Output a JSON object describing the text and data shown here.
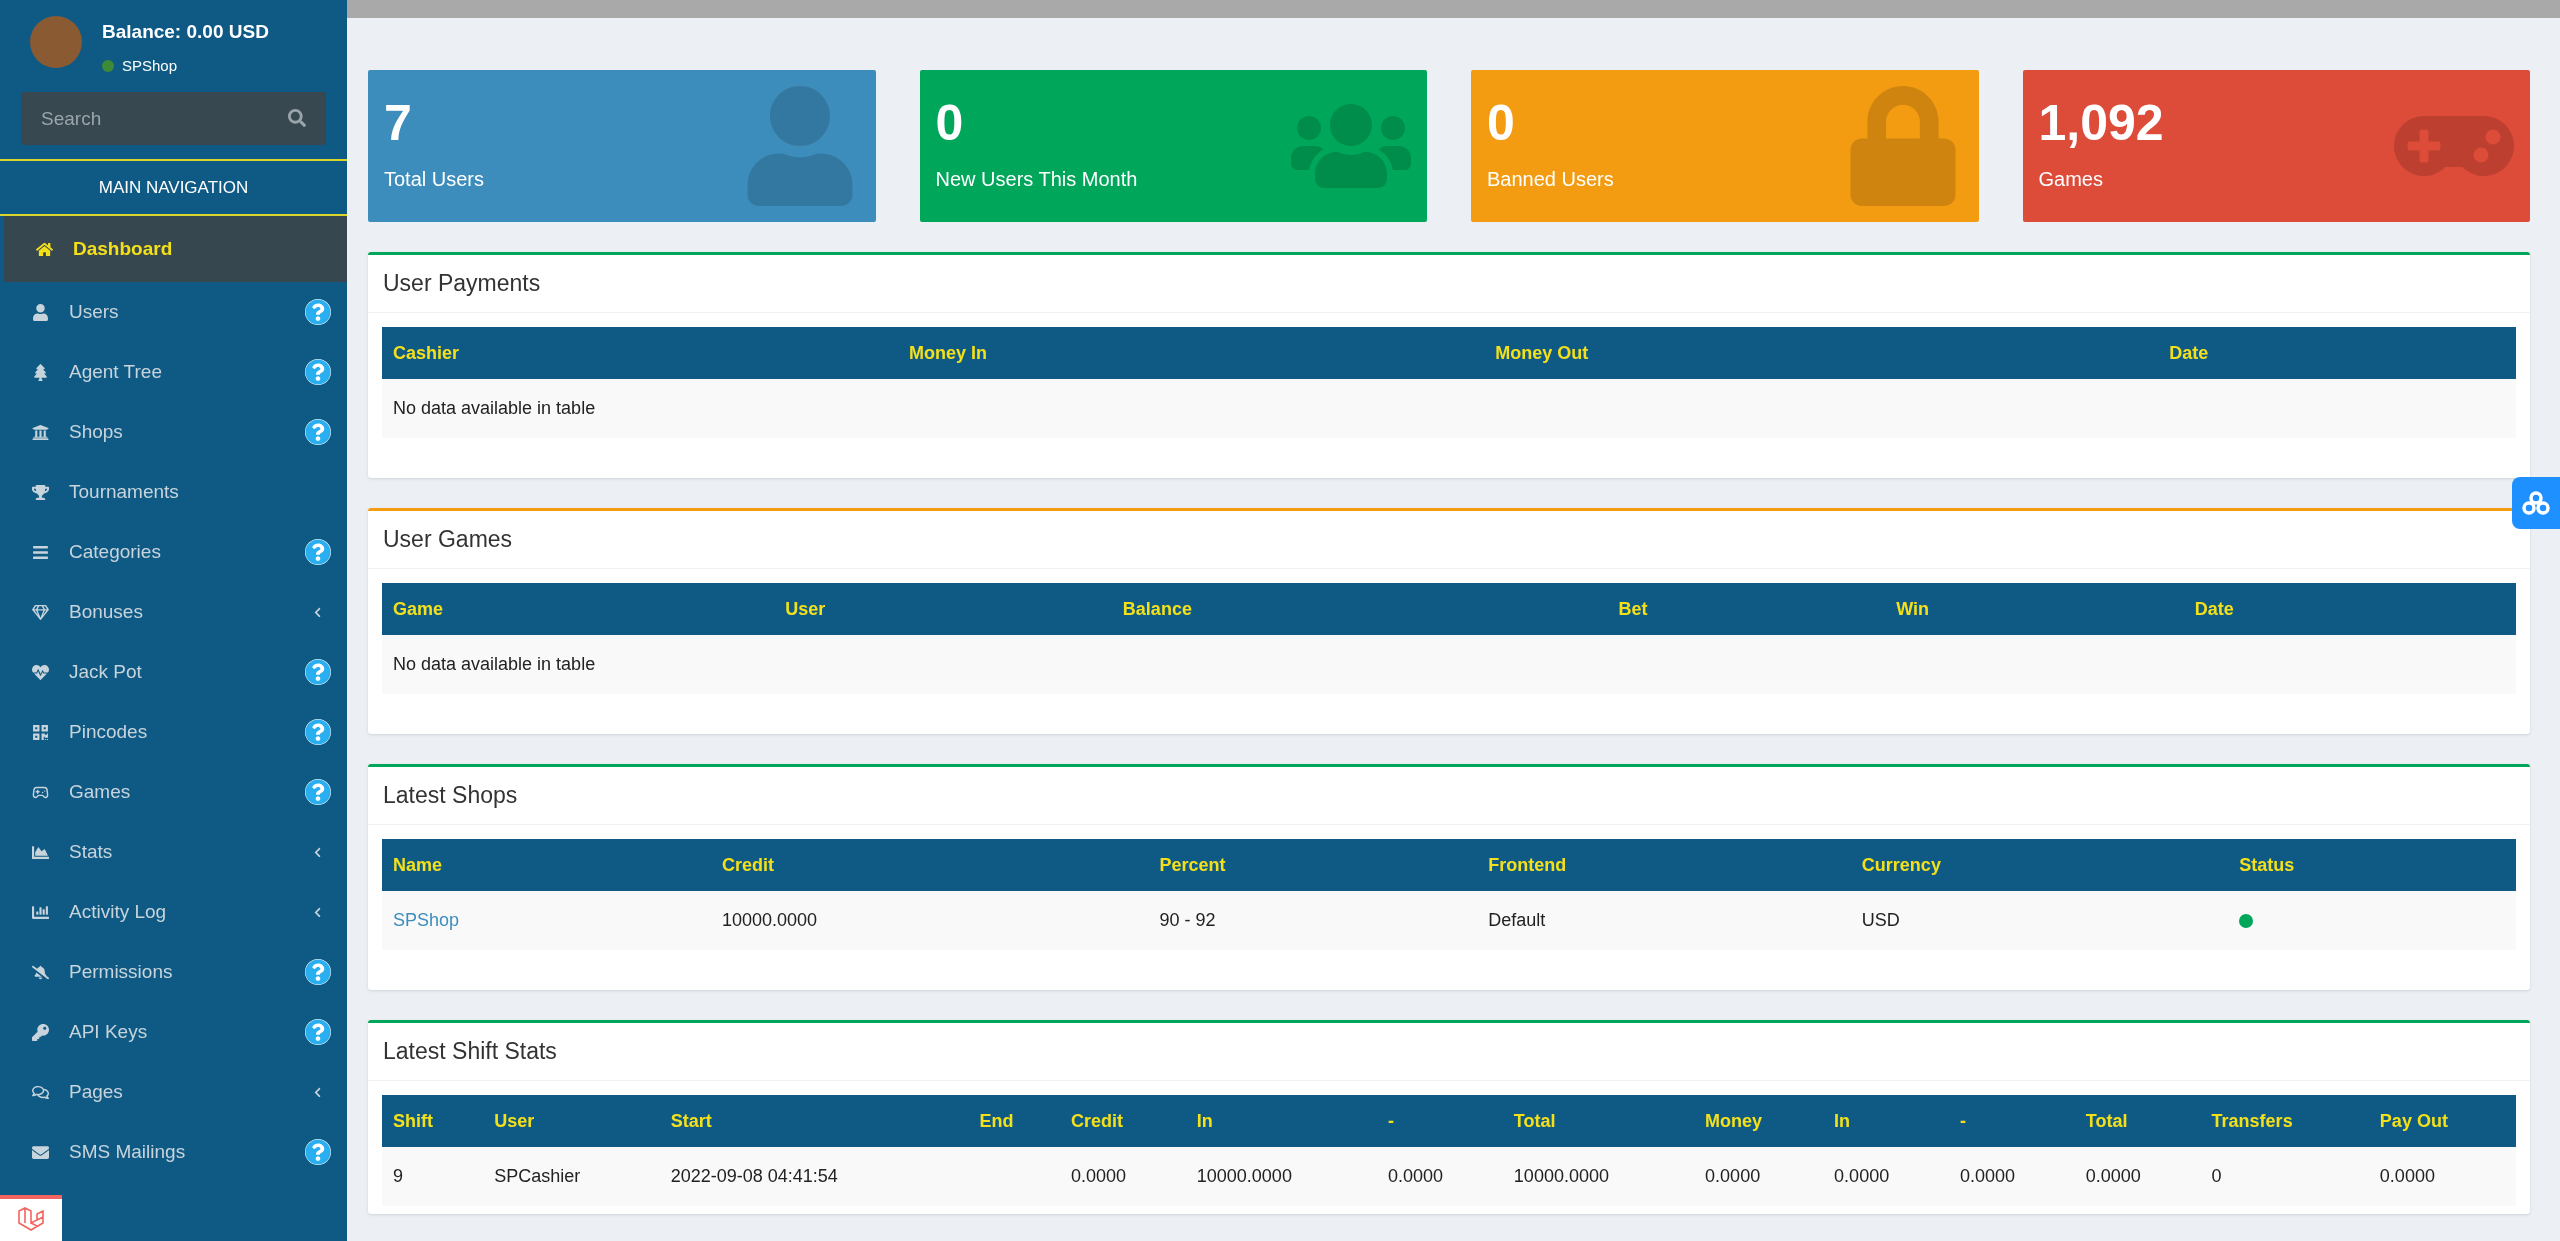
{
  "user_panel": {
    "balance": "Balance: 0.00 USD",
    "shop": "SPShop",
    "online": true
  },
  "search": {
    "placeholder": "Search"
  },
  "nav_heading": "MAIN NAVIGATION",
  "nav": [
    {
      "label": "Dashboard",
      "selected": true,
      "help": false,
      "submenu": false
    },
    {
      "label": "Users",
      "selected": false,
      "help": true,
      "submenu": false
    },
    {
      "label": "Agent Tree",
      "selected": false,
      "help": true,
      "submenu": false
    },
    {
      "label": "Shops",
      "selected": false,
      "help": true,
      "submenu": false
    },
    {
      "label": "Tournaments",
      "selected": false,
      "help": false,
      "submenu": false
    },
    {
      "label": "Categories",
      "selected": false,
      "help": true,
      "submenu": false
    },
    {
      "label": "Bonuses",
      "selected": false,
      "help": false,
      "submenu": true
    },
    {
      "label": "Jack Pot",
      "selected": false,
      "help": true,
      "submenu": false
    },
    {
      "label": "Pincodes",
      "selected": false,
      "help": true,
      "submenu": false
    },
    {
      "label": "Games",
      "selected": false,
      "help": true,
      "submenu": false
    },
    {
      "label": "Stats",
      "selected": false,
      "help": false,
      "submenu": true
    },
    {
      "label": "Activity Log",
      "selected": false,
      "help": false,
      "submenu": true
    },
    {
      "label": "Permissions",
      "selected": false,
      "help": true,
      "submenu": false
    },
    {
      "label": "API Keys",
      "selected": false,
      "help": true,
      "submenu": false
    },
    {
      "label": "Pages",
      "selected": false,
      "help": false,
      "submenu": true
    },
    {
      "label": "SMS Mailings",
      "selected": false,
      "help": true,
      "submenu": false
    }
  ],
  "stats": [
    {
      "value": "7",
      "label": "Total Users",
      "kind": "blue"
    },
    {
      "value": "0",
      "label": "New Users This Month",
      "kind": "green"
    },
    {
      "value": "0",
      "label": "Banned Users",
      "kind": "orange"
    },
    {
      "value": "1,092",
      "label": "Games",
      "kind": "red"
    }
  ],
  "panels": [
    {
      "title": "User Payments",
      "kind": "success",
      "columns": [
        "Cashier",
        "Money In",
        "Money Out",
        "Date"
      ],
      "empty_message": "No data available in table"
    },
    {
      "title": "User Games",
      "kind": "warning",
      "columns": [
        "Game",
        "User",
        "Balance",
        "Bet",
        "Win",
        "Date"
      ],
      "empty_message": "No data available in table"
    },
    {
      "title": "Latest Shops",
      "kind": "success",
      "columns": [
        "Name",
        "Credit",
        "Percent",
        "Frontend",
        "Currency",
        "Status"
      ],
      "rows": [
        {
          "cells": [
            {
              "kind": "link",
              "text": "SPShop"
            },
            {
              "kind": "text",
              "text": "10000.0000"
            },
            {
              "kind": "text",
              "text": "90 - 92"
            },
            {
              "kind": "text",
              "text": "Default"
            },
            {
              "kind": "text",
              "text": "USD"
            },
            {
              "kind": "dot",
              "color": "#00a65a"
            }
          ]
        }
      ]
    },
    {
      "title": "Latest Shift Stats",
      "kind": "success",
      "columns": [
        "Shift",
        "User",
        "Start",
        "End",
        "Credit",
        "In",
        "-",
        "Total",
        "Money",
        "In",
        "-",
        "Total",
        "Transfers",
        "Pay Out"
      ],
      "rows": [
        {
          "cells": [
            {
              "kind": "text",
              "text": "9"
            },
            {
              "kind": "text",
              "text": "SPCashier"
            },
            {
              "kind": "text",
              "text": "2022-09-08 04:41:54"
            },
            {
              "kind": "empty"
            },
            {
              "kind": "text",
              "text": "0.0000"
            },
            {
              "kind": "text",
              "text": "10000.0000"
            },
            {
              "kind": "text",
              "text": "0.0000"
            },
            {
              "kind": "text",
              "text": "10000.0000"
            },
            {
              "kind": "text",
              "text": "0.0000"
            },
            {
              "kind": "text",
              "text": "0.0000"
            },
            {
              "kind": "text",
              "text": "0.0000"
            },
            {
              "kind": "text",
              "text": "0.0000"
            },
            {
              "kind": "text",
              "text": "0"
            },
            {
              "kind": "text",
              "text": "0.0000"
            }
          ]
        }
      ]
    }
  ]
}
